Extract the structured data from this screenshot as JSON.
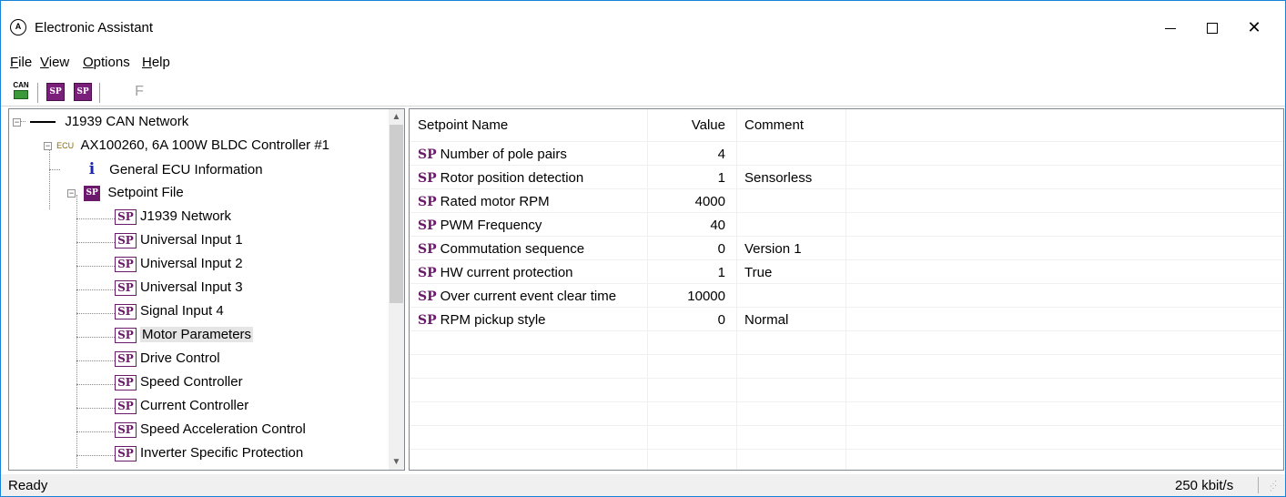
{
  "window": {
    "title": "Electronic Assistant",
    "min_glyph": "",
    "close_glyph": "✕"
  },
  "menu": {
    "items": [
      {
        "label": "File",
        "accel": "F",
        "rest": "ile"
      },
      {
        "label": "View",
        "accel": "V",
        "rest": "iew"
      },
      {
        "label": "Options",
        "accel": "O",
        "rest": "ptions"
      },
      {
        "label": "Help",
        "accel": "H",
        "rest": "elp"
      }
    ]
  },
  "toolbar": {
    "can_label": "CAN",
    "sp1_label": "SP",
    "sp2_label": "SP",
    "f_label": "F"
  },
  "tree": {
    "root": "J1939 CAN Network",
    "ecu_tag": "ECU",
    "ecu": "AX100260, 6A 100W BLDC Controller #1",
    "info_glyph": "i",
    "info": "General ECU Information",
    "setpoint_icon": "SP",
    "setpoint_file": "Setpoint File",
    "sp_icon": "SP",
    "items": [
      "J1939 Network",
      "Universal Input 1",
      "Universal Input 2",
      "Universal Input 3",
      "Signal Input 4",
      "Motor Parameters",
      "Drive Control",
      "Speed Controller",
      "Current Controller",
      "Speed Acceleration Control",
      "Inverter Specific Protection"
    ],
    "selected": "Motor Parameters"
  },
  "grid": {
    "columns": [
      "Setpoint Name",
      "Value",
      "Comment"
    ],
    "sp_tag": "SP",
    "rows": [
      {
        "name": "Number of pole pairs",
        "value": "4",
        "comment": ""
      },
      {
        "name": "Rotor position detection",
        "value": "1",
        "comment": "Sensorless"
      },
      {
        "name": "Rated motor RPM",
        "value": "4000",
        "comment": ""
      },
      {
        "name": "PWM Frequency",
        "value": "40",
        "comment": ""
      },
      {
        "name": "Commutation sequence",
        "value": "0",
        "comment": "Version 1"
      },
      {
        "name": "HW current protection",
        "value": "1",
        "comment": "True"
      },
      {
        "name": "Over current event clear time",
        "value": "10000",
        "comment": ""
      },
      {
        "name": "RPM pickup style",
        "value": "0",
        "comment": "Normal"
      }
    ]
  },
  "status": {
    "left": "Ready",
    "right": "250 kbit/s"
  },
  "colors": {
    "accent_border": "#1883d7",
    "sp_purple": "#6b1a6b",
    "info_blue": "#1a2aa8",
    "selected_bg": "#e5e5e5"
  }
}
